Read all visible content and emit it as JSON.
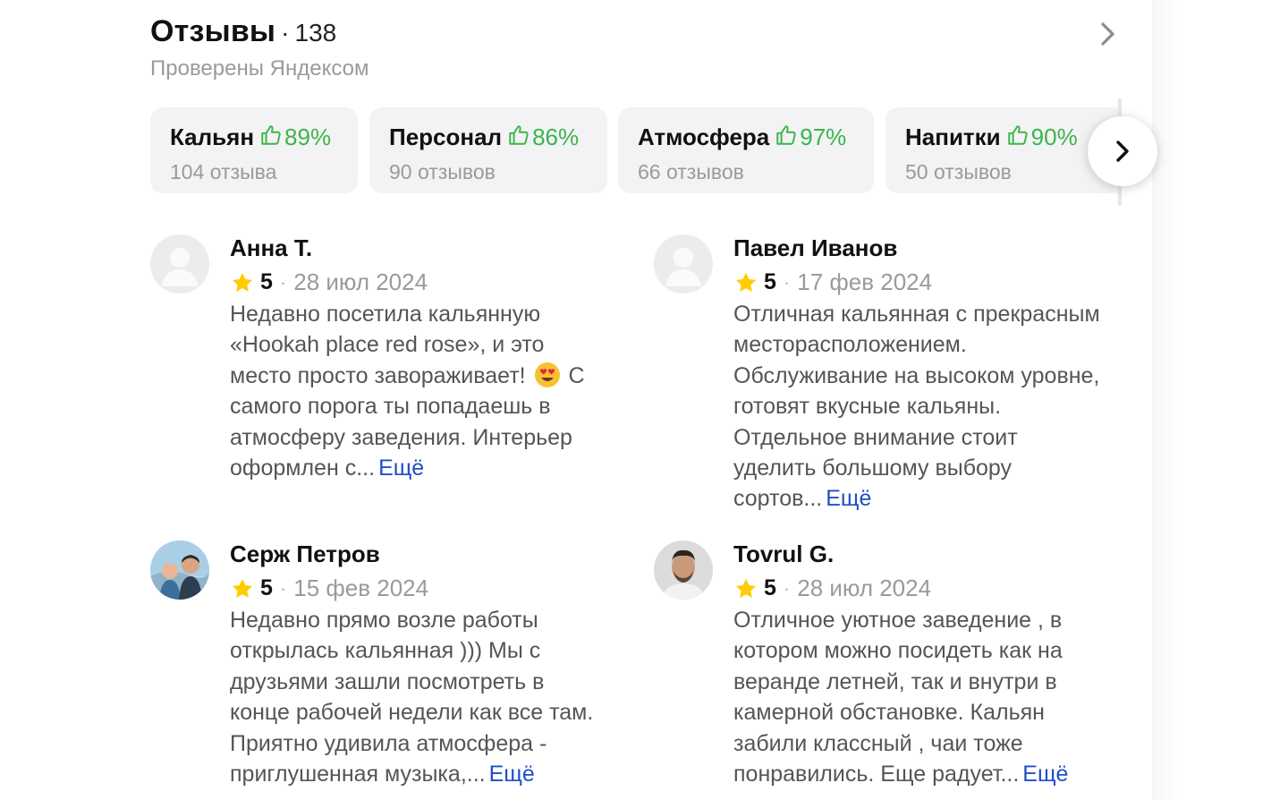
{
  "reviews_header": {
    "title": "Отзывы",
    "separator": "·",
    "count": "138",
    "subtitle": "Проверены Яндексом",
    "arrow_icon": "chevron-right-icon"
  },
  "topics": [
    {
      "name": "Кальян",
      "percent": "89%",
      "reviews": "104 отзыва"
    },
    {
      "name": "Персонал",
      "percent": "86%",
      "reviews": "90 отзывов"
    },
    {
      "name": "Атмосфера",
      "percent": "97%",
      "reviews": "66 отзывов"
    },
    {
      "name": "Напитки",
      "percent": "90%",
      "reviews": "50 отзывов"
    }
  ],
  "topic_icon": "thumbs-up-icon",
  "next_icon": "chevron-right-icon",
  "colors": {
    "accent_green": "#3bb54a",
    "link_blue": "#1f4ec9",
    "star": "#ffcc00"
  },
  "reviews": [
    {
      "author": "Анна Т.",
      "rating": "5",
      "separator": "·",
      "date": "28 июл 2024",
      "lines": [
        "Недавно посетила кальянную",
        "«Hookah place red rose», и это",
        "место просто завораживает!",
        "самого порога ты попадаешь в",
        "атмосферу заведения. Интерьер",
        "оформлен с..."
      ],
      "line3_tail": "С",
      "more": "Ещё"
    },
    {
      "author": "Павел Иванов",
      "rating": "5",
      "separator": "·",
      "date": "17 фев 2024",
      "lines": [
        "Отличная кальянная с прекрасным",
        "месторасположением.",
        "Обслуживание на высоком уровне,",
        "готовят вкусные кальяны.",
        "Отдельное внимание стоит",
        "уделить большому выбору",
        "сортов..."
      ],
      "more": "Ещё"
    },
    {
      "author": "Серж Петров",
      "rating": "5",
      "separator": "·",
      "date": "15 фев 2024",
      "lines": [
        "Недавно прямо возле работы",
        "открылась кальянная ))) Мы с",
        "друзьями зашли посмотреть в",
        "конце рабочей недели как все там.",
        "Приятно удивила атмосфера -",
        "приглушенная музыка,..."
      ],
      "more": "Ещё"
    },
    {
      "author": "Tovrul G.",
      "rating": "5",
      "separator": "·",
      "date": "28 июл 2024",
      "lines": [
        "Отличное уютное заведение , в",
        "котором можно посидеть как на",
        "веранде летней, так и внутри в",
        "камерной обстановке. Кальян",
        "забили классный , чаи тоже",
        "понравились. Еще радует..."
      ],
      "more": "Ещё"
    }
  ]
}
